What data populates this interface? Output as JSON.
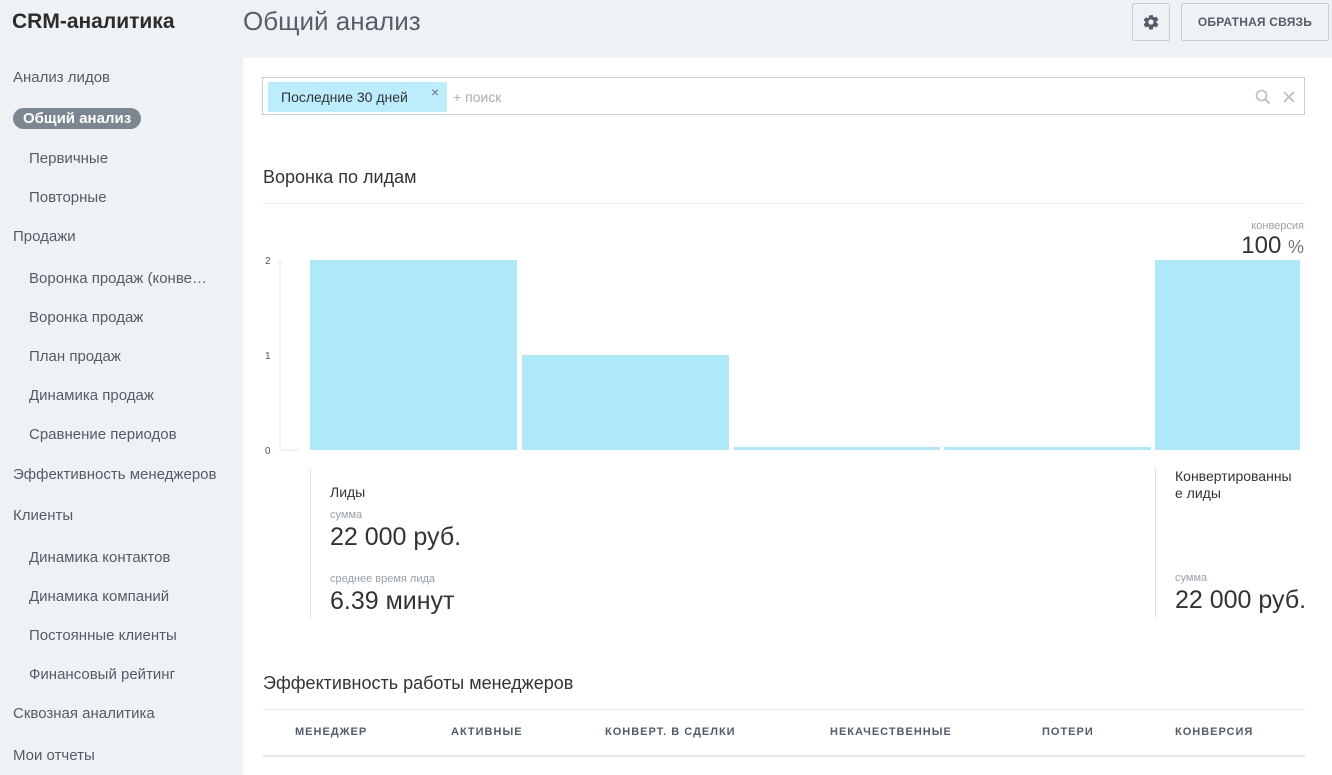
{
  "app": {
    "title": "CRM-аналитика"
  },
  "header": {
    "title": "Общий анализ",
    "gear_icon": "gear-icon",
    "feedback_label": "ОБРАТНАЯ СВЯЗЬ"
  },
  "sidebar": {
    "items": [
      {
        "label": "Анализ лидов",
        "level": 0
      },
      {
        "label": "Общий анализ",
        "level": 1,
        "active": true
      },
      {
        "label": "Первичные",
        "level": 1
      },
      {
        "label": "Повторные",
        "level": 1
      },
      {
        "label": "Продажи",
        "level": 0
      },
      {
        "label": "Воронка продаж (конверсия)",
        "level": 1
      },
      {
        "label": "Воронка продаж",
        "level": 1
      },
      {
        "label": "План продаж",
        "level": 1
      },
      {
        "label": "Динамика продаж",
        "level": 1
      },
      {
        "label": "Сравнение периодов",
        "level": 1
      },
      {
        "label": "Эффективность менеджеров",
        "level": 0
      },
      {
        "label": "Клиенты",
        "level": 0
      },
      {
        "label": "Динамика контактов",
        "level": 1
      },
      {
        "label": "Динамика компаний",
        "level": 1
      },
      {
        "label": "Постоянные клиенты",
        "level": 1
      },
      {
        "label": "Финансовый рейтинг",
        "level": 1
      },
      {
        "label": "Сквозная аналитика",
        "level": 0
      },
      {
        "label": "Мои отчеты",
        "level": 0
      }
    ]
  },
  "filter": {
    "tag_label": "Последние 30 дней",
    "tag_close": "×",
    "search_placeholder": "+ поиск",
    "search_value": ""
  },
  "funnel": {
    "title": "Воронка по лидам",
    "conversion_label": "конверсия",
    "conversion_value": "100",
    "conversion_unit": "%",
    "leads": {
      "title": "Лиды",
      "sum_label": "сумма",
      "sum_value": "22 000 руб.",
      "avg_label": "среднее время лида",
      "avg_value": "6.39 минут"
    },
    "converted": {
      "title": "Конвертированные лиды",
      "sum_label": "сумма",
      "sum_value": "22 000 руб."
    }
  },
  "chart_data": {
    "type": "bar",
    "categories": [
      "",
      "",
      "",
      "",
      ""
    ],
    "values": [
      2,
      1,
      0,
      0,
      2
    ],
    "yticks": [
      "0",
      "1",
      "2"
    ],
    "ylim": [
      0,
      2
    ],
    "color": "#aee9f9",
    "grid": false
  },
  "managers": {
    "title": "Эффективность работы менеджеров",
    "columns": [
      "МЕНЕДЖЕР",
      "АКТИВНЫЕ",
      "КОНВЕРТ. В СДЕЛКИ",
      "НЕКАЧЕСТВЕННЫЕ",
      "ПОТЕРИ",
      "КОНВЕРСИЯ"
    ]
  }
}
